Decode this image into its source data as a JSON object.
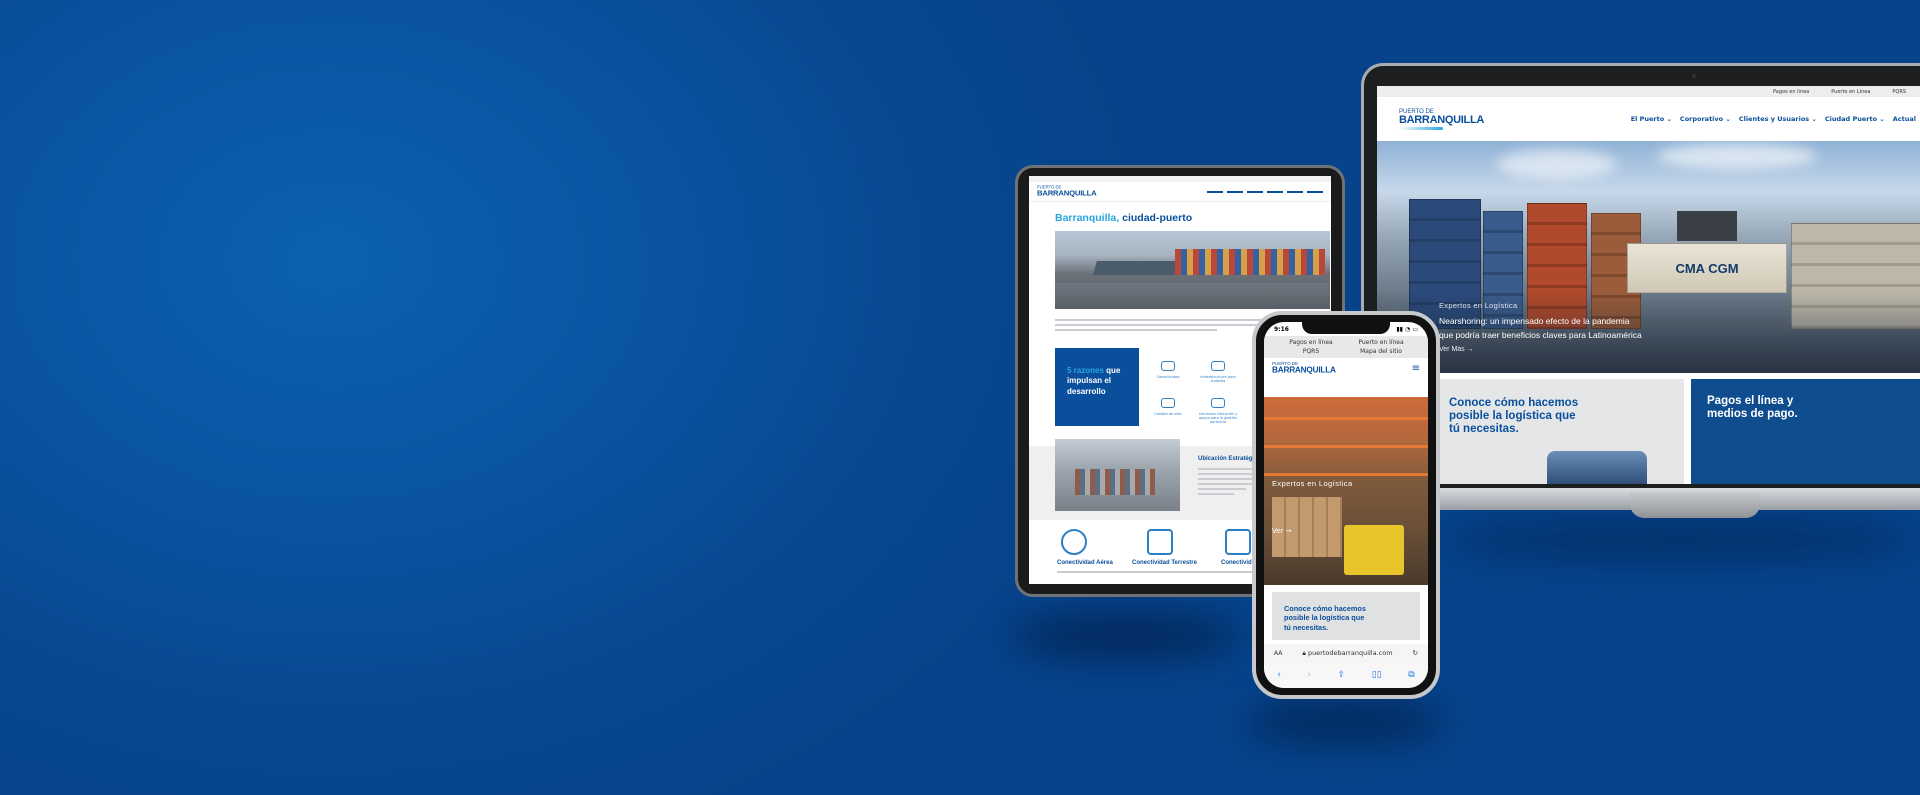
{
  "background": {
    "color": "#0a4f9c"
  },
  "laptop": {
    "utility_links": [
      "Pagos en linea",
      "Puerto en Línea",
      "PQRS"
    ],
    "logo": {
      "line1": "PUERTO DE",
      "line2": "BARRANQUILLA"
    },
    "menu": [
      "El Puerto ⌄",
      "Corporativo ⌄",
      "Clientes y Usuarios ⌄",
      "Ciudad Puerto ⌄",
      "Actual"
    ],
    "hero": {
      "container_brand": "CMA CGM",
      "kicker": "Expertos en Logística",
      "headline_1": "Nearshoring: un impensado efecto de la pandemia",
      "headline_2": "que podría traer beneficios claves para Latinoamérica",
      "more": "Ver Más"
    },
    "card_logistics": {
      "l1": "Conoce cómo hacemos",
      "l2": "posible la logística que",
      "l3": "tú necesitas."
    },
    "card_payments": {
      "l1": "Pagos el línea y",
      "l2": "medios de pago."
    }
  },
  "tablet": {
    "logo": {
      "line1": "PUERTO DE",
      "line2": "BARRANQUILLA"
    },
    "title_highlight": "Barranquilla,",
    "title_rest": " ciudad-puerto",
    "reasons": {
      "highlight": "5 razones",
      "rest1": " que",
      "rest2": "impulsan el",
      "rest3": "desarrollo"
    },
    "features": [
      "Conectividad",
      "Infraestructura para sudarios",
      "Calidad de vida",
      "Cercanías Ubicación y apoyo para la gestión portuaria"
    ],
    "location_title": "Ubicación Estratégica",
    "connectivity": [
      "Conectividad Aérea",
      "Conectividad Terrestre",
      "Conectivid"
    ]
  },
  "phone": {
    "time": "9:16",
    "utility_links": [
      "Pagos en línea",
      "Puerto en línea",
      "PQRS",
      "Mapa del sitio"
    ],
    "logo": {
      "line1": "PUERTO DE",
      "line2": "BARRANQUILLA"
    },
    "hamburger": "≡",
    "hero_kicker": "Expertos en Logística",
    "hero_more": "Ver",
    "card": {
      "l1": "Conoce cómo hacemos",
      "l2": "posible la logística que",
      "l3": "tú necesitas."
    },
    "url_prefix": "AA",
    "url": "puertodebarranquilla.com"
  },
  "colors": {
    "brand_blue": "#0a4f9c",
    "accent_cyan": "#29a6e0",
    "orange_racks": "#e47936"
  }
}
